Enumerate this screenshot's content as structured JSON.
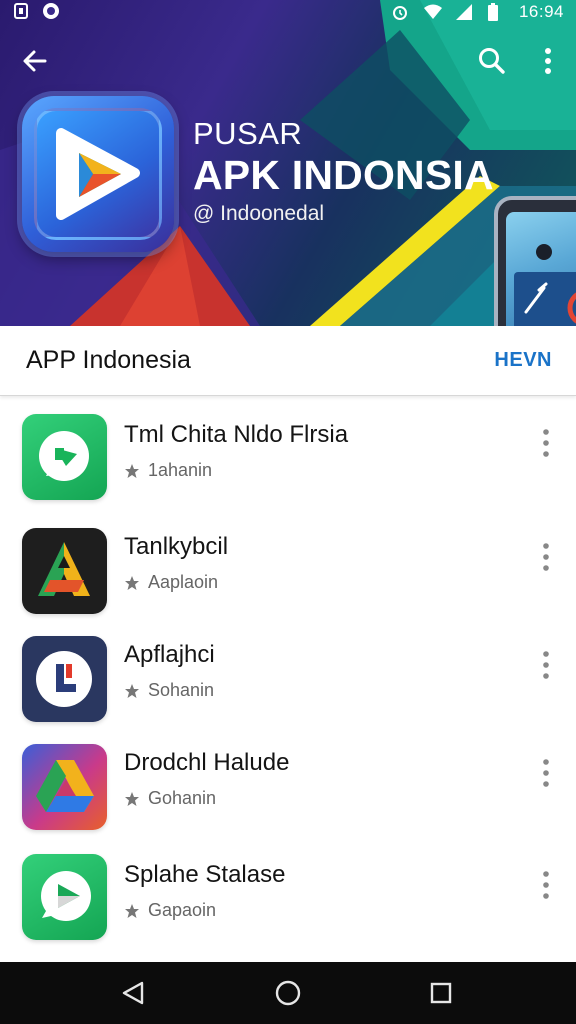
{
  "status_bar": {
    "time": "16:94",
    "left_icons": [
      "notification-icon",
      "record-icon"
    ],
    "right_icons": [
      "alarm-icon",
      "wifi-icon",
      "signal-icon",
      "battery-icon"
    ]
  },
  "top_bar": {
    "back_icon": "arrow-left-icon",
    "search_icon": "search-icon",
    "more_icon": "more-vert-icon"
  },
  "hero": {
    "title_line1": "PUSAR",
    "title_line2": "APK INDONSIA",
    "subtitle": "@ Indoonedal",
    "logo_icon": "play-icon"
  },
  "section": {
    "title": "APP Indonesia",
    "action": "HEVN"
  },
  "apps": [
    {
      "name": "Tml Chita Nldo Flrsia",
      "meta": "1ahanin",
      "icon": "chat-bubble-icon"
    },
    {
      "name": "Tanlkybcil",
      "meta": "Aaplaoin",
      "icon": "triangle-a-icon"
    },
    {
      "name": "Apflajhci",
      "meta": "Sohanin",
      "icon": "circle-l-icon"
    },
    {
      "name": "Drodchl Halude",
      "meta": "Gohanin",
      "icon": "drive-icon"
    },
    {
      "name": "Splahe Stalase",
      "meta": "Gapaoin",
      "icon": "speech-play-icon"
    }
  ],
  "nav_bar": {
    "back": "nav-back-icon",
    "home": "nav-home-icon",
    "recents": "nav-recents-icon"
  },
  "colors": {
    "accent": "#1a73c8",
    "nav_bg": "#0c0c0c",
    "hero_purple": "#2a1a6e",
    "hero_teal": "#0f5c5a"
  }
}
